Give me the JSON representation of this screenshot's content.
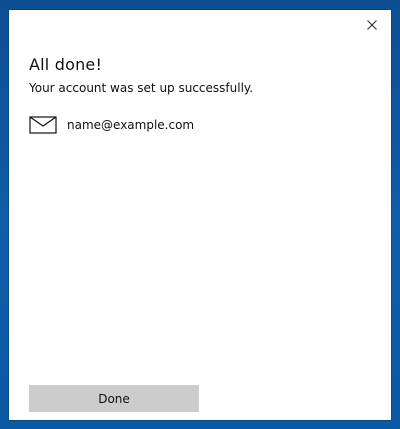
{
  "dialog": {
    "title": "All done!",
    "subtitle": "Your account was set up successfully.",
    "close_icon": "close-icon",
    "account": {
      "icon": "mail-icon",
      "email": "name@example.com"
    },
    "done_label": "Done"
  },
  "colors": {
    "desktop_background": "#0f5ca8",
    "dialog_background": "#ffffff",
    "button_background": "#cccccc",
    "text": "#111111"
  }
}
